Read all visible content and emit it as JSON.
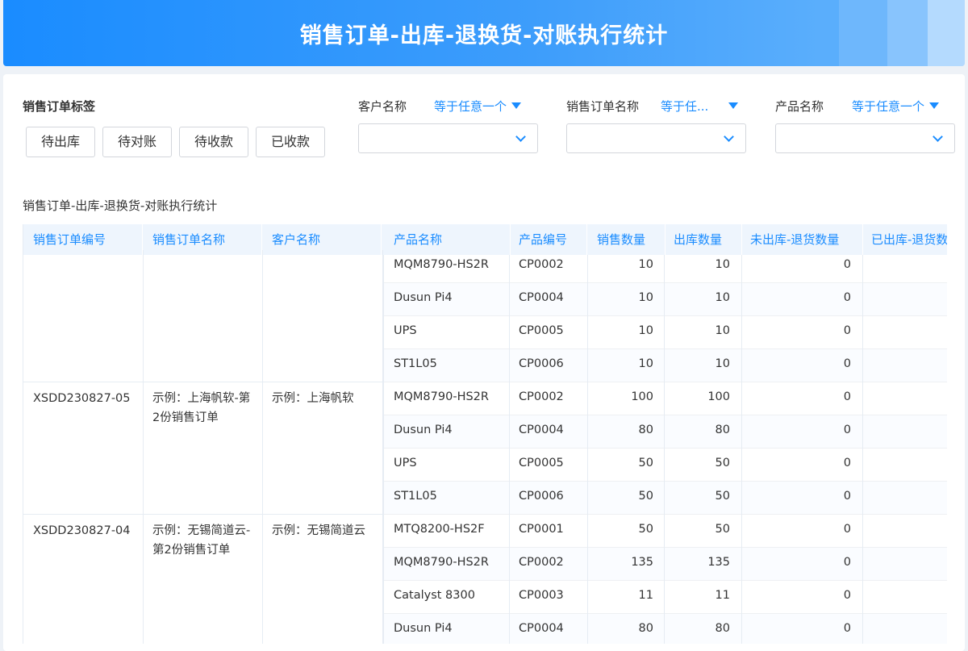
{
  "header": {
    "title": "销售订单-出库-退换货-对账执行统计"
  },
  "filters": {
    "tag_label": "销售订单标签",
    "tags": [
      "待出库",
      "待对账",
      "待收款",
      "已收款"
    ],
    "customer": {
      "label": "客户名称",
      "op": "等于任意一个"
    },
    "order_name": {
      "label": "销售订单名称",
      "op": "等于任..."
    },
    "product": {
      "label": "产品名称",
      "op": "等于任意一个"
    }
  },
  "table": {
    "title": "销售订单-出库-退换货-对账执行统计",
    "columns": [
      "销售订单编号",
      "销售订单名称",
      "客户名称",
      "产品名称",
      "产品编号",
      "销售数量",
      "出库数量",
      "未出库-退货数量",
      "已出库-退货数"
    ],
    "groups": [
      {
        "order_no": "",
        "order_name": "",
        "customer": "",
        "rows": [
          {
            "product": "MQM8790-HS2R",
            "code": "CP0002",
            "sales_qty": "10",
            "out_qty": "10",
            "not_out_return": "0"
          },
          {
            "product": "Dusun Pi4",
            "code": "CP0004",
            "sales_qty": "10",
            "out_qty": "10",
            "not_out_return": "0"
          },
          {
            "product": "UPS",
            "code": "CP0005",
            "sales_qty": "10",
            "out_qty": "10",
            "not_out_return": "0"
          },
          {
            "product": "ST1L05",
            "code": "CP0006",
            "sales_qty": "10",
            "out_qty": "10",
            "not_out_return": "0"
          }
        ]
      },
      {
        "order_no": "XSDD230827-05",
        "order_name": "示例：上海帆软-第2份销售订单",
        "customer": "示例：上海帆软",
        "rows": [
          {
            "product": "MQM8790-HS2R",
            "code": "CP0002",
            "sales_qty": "100",
            "out_qty": "100",
            "not_out_return": "0"
          },
          {
            "product": "Dusun Pi4",
            "code": "CP0004",
            "sales_qty": "80",
            "out_qty": "80",
            "not_out_return": "0"
          },
          {
            "product": "UPS",
            "code": "CP0005",
            "sales_qty": "50",
            "out_qty": "50",
            "not_out_return": "0"
          },
          {
            "product": "ST1L05",
            "code": "CP0006",
            "sales_qty": "50",
            "out_qty": "50",
            "not_out_return": "0"
          }
        ]
      },
      {
        "order_no": "XSDD230827-04",
        "order_name": "示例：无锡简道云-第2份销售订单",
        "customer": "示例：无锡简道云",
        "rows": [
          {
            "product": "MTQ8200-HS2F",
            "code": "CP0001",
            "sales_qty": "50",
            "out_qty": "50",
            "not_out_return": "0"
          },
          {
            "product": "MQM8790-HS2R",
            "code": "CP0002",
            "sales_qty": "135",
            "out_qty": "135",
            "not_out_return": "0"
          },
          {
            "product": "Catalyst 8300",
            "code": "CP0003",
            "sales_qty": "11",
            "out_qty": "11",
            "not_out_return": "0"
          },
          {
            "product": "Dusun Pi4",
            "code": "CP0004",
            "sales_qty": "80",
            "out_qty": "80",
            "not_out_return": "0"
          }
        ]
      }
    ]
  }
}
